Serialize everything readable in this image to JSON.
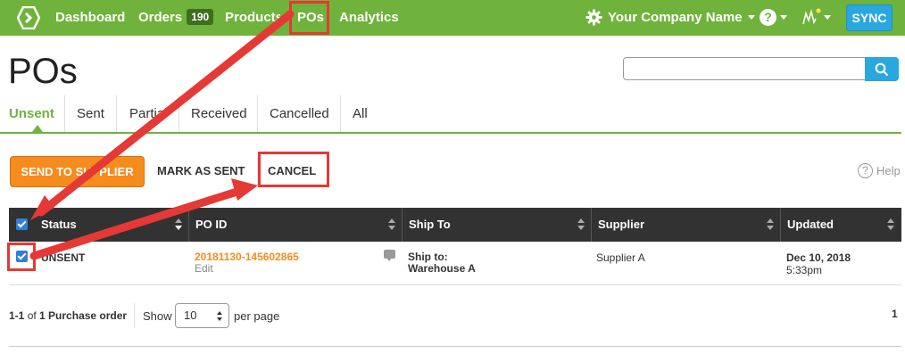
{
  "nav": {
    "links": [
      {
        "label": "Dashboard"
      },
      {
        "label": "Orders",
        "badge": "190"
      },
      {
        "label": "Products"
      },
      {
        "label": "POs"
      },
      {
        "label": "Analytics"
      }
    ],
    "company": "Your Company Name",
    "sync_label": "SYNC",
    "help_glyph": "?",
    "icons": {
      "logo": "logo-icon",
      "company": "gear-icon",
      "help": "help-icon",
      "activity": "activity-icon"
    }
  },
  "page": {
    "title": "POs",
    "search_placeholder": ""
  },
  "tabs": [
    {
      "label": "Unsent"
    },
    {
      "label": "Sent"
    },
    {
      "label": "Partial"
    },
    {
      "label": "Received"
    },
    {
      "label": "Cancelled"
    },
    {
      "label": "All"
    }
  ],
  "actions": {
    "send_label": "SEND TO SUPPLIER",
    "mark_label": "MARK AS SENT",
    "cancel_label": "CANCEL",
    "help_label": "Help"
  },
  "table": {
    "headers": [
      "Status",
      "PO ID",
      "Ship To",
      "Supplier",
      "Updated"
    ],
    "rows": [
      {
        "status": "UNSENT",
        "po_id": "20181130-145602865",
        "edit": "Edit",
        "ship_to_label": "Ship to:",
        "ship_to": "Warehouse A",
        "supplier": "Supplier A",
        "updated_date": "Dec 10, 2018",
        "updated_time": "5:33pm"
      }
    ]
  },
  "footer": {
    "range": "1-1",
    "of_word": "of",
    "total": "1 Purchase order",
    "show_label": "Show",
    "per_page_value": "10",
    "per_page_label": "per page",
    "page_number": "1"
  },
  "colors": {
    "nav_bg": "#6fb33c",
    "accent_orange": "#f68b1e",
    "sync_blue": "#29a8e0",
    "annotation_red": "#e53935"
  }
}
